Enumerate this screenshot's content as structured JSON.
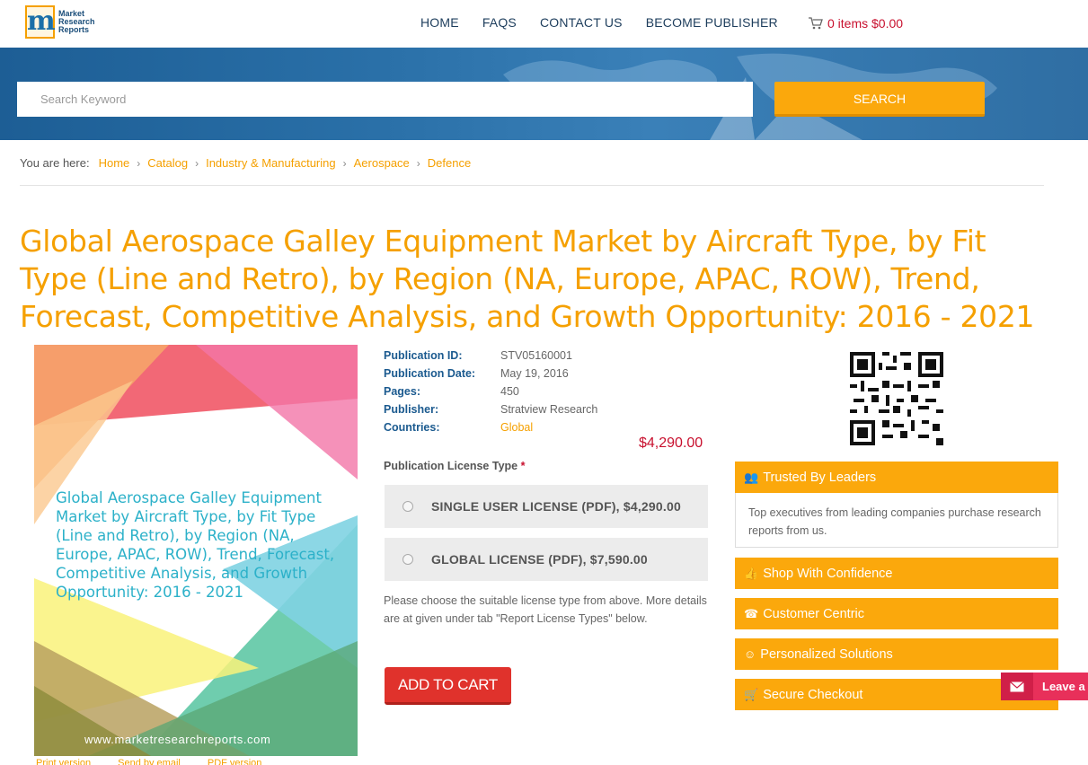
{
  "brand": {
    "logo_letter": "m",
    "logo_line1": "Market",
    "logo_line2": "Research",
    "logo_line3": "Reports"
  },
  "nav": {
    "items": [
      "HOME",
      "FAQS",
      "CONTACT US",
      "BECOME PUBLISHER"
    ]
  },
  "cart": {
    "label": "0 items $0.00",
    "icon": "cart-icon"
  },
  "search": {
    "placeholder": "Search Keyword",
    "button": "SEARCH"
  },
  "breadcrumb": {
    "lead": "You are here:",
    "items": [
      "Home",
      "Catalog",
      "Industry & Manufacturing",
      "Aerospace",
      "Defence"
    ]
  },
  "report": {
    "title": "Global Aerospace Galley Equipment Market by Aircraft Type, by Fit Type (Line and Retro), by Region (NA, Europe, APAC, ROW), Trend, Forecast, Competitive Analysis, and Growth Opportunity: 2016 - 2021",
    "cover_title": "Global Aerospace Galley Equipment Market by Aircraft Type, by Fit Type (Line and Retro), by Region (NA, Europe, APAC, ROW), Trend, Forecast, Competitive Analysis, and Growth Opportunity: 2016 - 2021",
    "cover_url": "www.marketresearchreports.com"
  },
  "info": {
    "publication_id_label": "Publication ID:",
    "publication_id": "STV05160001",
    "publication_date_label": "Publication Date:",
    "publication_date": "May 19, 2016",
    "pages_label": "Pages:",
    "pages": "450",
    "publisher_label": "Publisher:",
    "publisher": "Stratview Research",
    "countries_label": "Countries:",
    "countries": "Global"
  },
  "price": "$4,290.00",
  "license": {
    "heading": "Publication License Type",
    "required_mark": "*",
    "options": [
      "SINGLE USER LICENSE (PDF), $4,290.00",
      "GLOBAL LICENSE (PDF), $7,590.00"
    ],
    "note": "Please choose the suitable license type from above. More details are at given under tab \"Report License Types\" below."
  },
  "add_to_cart": "ADD TO CART",
  "bottom_links": [
    "Print version",
    "Send by email",
    "PDF version"
  ],
  "sidebar": {
    "trusted_title": "Trusted By Leaders",
    "trusted_body": "Top executives from leading companies purchase research reports from us.",
    "shop": "Shop With Confidence",
    "customer": "Customer Centric",
    "personalized": "Personalized Solutions",
    "secure": "Secure Checkout"
  },
  "chat": {
    "label": "Leave a"
  },
  "colors": {
    "accent": "#f5a000",
    "button": "#fba80c",
    "price": "#c8102e",
    "cart_button": "#e0322c",
    "nav": "#1d3d5c"
  }
}
